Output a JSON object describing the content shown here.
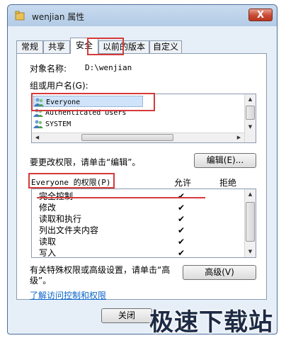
{
  "window": {
    "title": "wenjian 属性",
    "close_symbol": "X"
  },
  "tabs": [
    {
      "label": "常规"
    },
    {
      "label": "共享"
    },
    {
      "label": "安全"
    },
    {
      "label": "以前的版本"
    },
    {
      "label": "自定义"
    }
  ],
  "security": {
    "object_name_label": "对象名称:",
    "object_name_value": "D:\\wenjian",
    "group_label": "组或用户名(G):",
    "users": [
      {
        "name": "Everyone",
        "selected": true
      },
      {
        "name": "Authenticated Users",
        "selected": false
      },
      {
        "name": "SYSTEM",
        "selected": false
      }
    ],
    "change_perm_text": "要更改权限，请单击“编辑”。",
    "edit_button": "编辑(E)...",
    "perm_header": "Everyone 的权限(P)",
    "allow_header": "允许",
    "deny_header": "拒绝",
    "permissions": [
      {
        "name": "完全控制",
        "allow": "✔"
      },
      {
        "name": "修改",
        "allow": "✔"
      },
      {
        "name": "读取和执行",
        "allow": "✔"
      },
      {
        "name": "列出文件夹内容",
        "allow": "✔"
      },
      {
        "name": "读取",
        "allow": "✔"
      },
      {
        "name": "写入",
        "allow": "✔"
      }
    ],
    "advanced_text_1": "有关特殊权限或高级设置，请单击“高",
    "advanced_text_2": "级”。",
    "advanced_button": "高级(V)",
    "learn_link": "了解访问控制和权限"
  },
  "footer": {
    "close_button": "关闭"
  },
  "watermark": "极速下载站",
  "colors": {
    "highlight": "#d63a3a",
    "selection": "#cfe4fa",
    "link": "#0b64c9"
  }
}
